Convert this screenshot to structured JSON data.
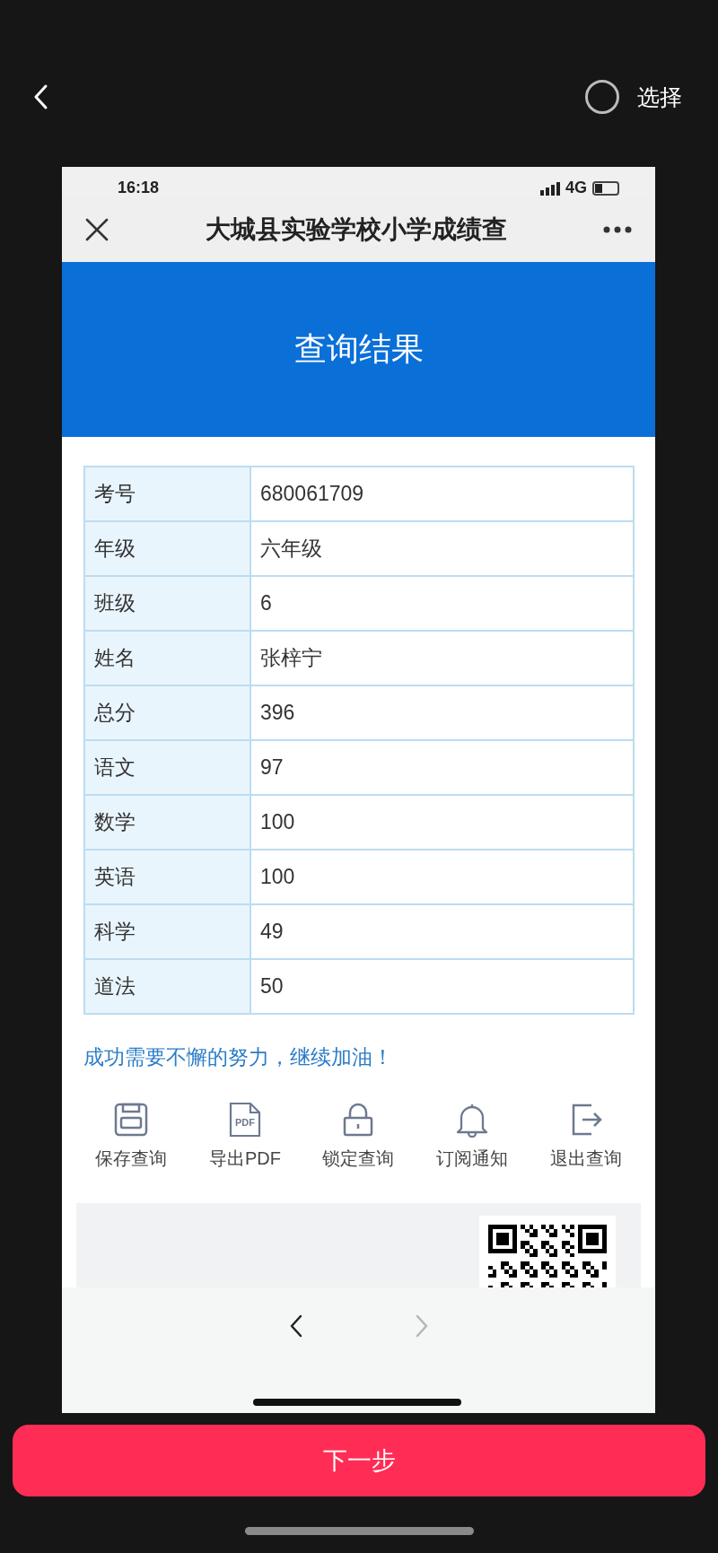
{
  "app_bar": {
    "select_label": "选择",
    "selected": false
  },
  "phone": {
    "status": {
      "time": "16:18",
      "network": "4G"
    },
    "nav": {
      "title": "大城县实验学校小学成绩查"
    },
    "banner": {
      "title": "查询结果"
    },
    "table": {
      "rows": [
        {
          "label": "考号",
          "value": "680061709"
        },
        {
          "label": "年级",
          "value": "六年级"
        },
        {
          "label": "班级",
          "value": "6"
        },
        {
          "label": "姓名",
          "value": "张梓宁"
        },
        {
          "label": "总分",
          "value": "396"
        },
        {
          "label": "语文",
          "value": "97"
        },
        {
          "label": "数学",
          "value": "100"
        },
        {
          "label": "英语",
          "value": "100"
        },
        {
          "label": "科学",
          "value": "49"
        },
        {
          "label": "道法",
          "value": "50"
        }
      ]
    },
    "message": "成功需要不懈的努力，继续加油！",
    "actions": [
      {
        "label": "保存查询",
        "kind": "save"
      },
      {
        "label": "导出PDF",
        "kind": "pdf",
        "icon_text": "PDF"
      },
      {
        "label": "锁定查询",
        "kind": "lock"
      },
      {
        "label": "订阅通知",
        "kind": "bell"
      },
      {
        "label": "退出查询",
        "kind": "exit"
      }
    ],
    "browser": {
      "back_disabled": false,
      "forward_disabled": true
    }
  },
  "next_button": {
    "label": "下一步"
  }
}
